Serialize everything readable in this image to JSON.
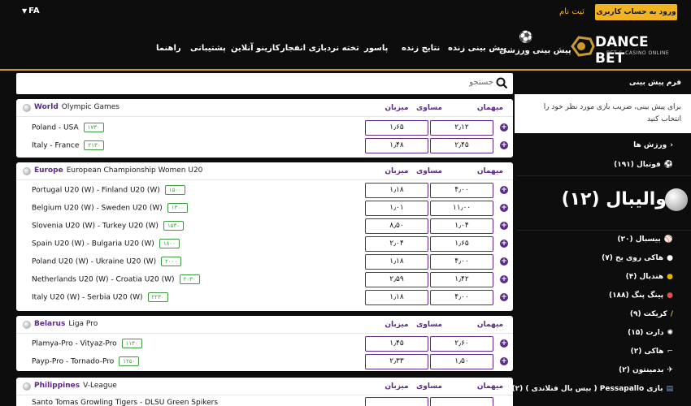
{
  "topbar": {
    "language": "FA",
    "login_label": "ورود به حساب کاربری",
    "register_label": "ثبت نام"
  },
  "header": {
    "logo_text": "DANCE BET",
    "logo_tagline": "BET & CASINO ONLINE",
    "sport_prediction_label": "پیش بینی ورزشی",
    "nav": [
      "پیش بینی زنده",
      "نتایج زنده",
      "پاسور",
      "تخته نرد",
      "بازی انفجار",
      "کازینو آنلاین",
      "پشتیبانی",
      "راهنما"
    ]
  },
  "search": {
    "placeholder": "جستجو"
  },
  "columns": {
    "home": "میزبان",
    "draw": "مساوی",
    "away": "میهمان"
  },
  "leagues": [
    {
      "region": "World",
      "name": "Olympic Games",
      "matches": [
        {
          "teams": "Poland - USA",
          "more": "۱۷۳۰",
          "home": "۱٫۶۵",
          "draw": "",
          "away": "۲٫۱۲"
        },
        {
          "teams": "Italy - France",
          "more": "۲۱۳۰",
          "home": "۱٫۴۸",
          "draw": "",
          "away": "۲٫۴۵"
        }
      ]
    },
    {
      "region": "Europe",
      "name": "European Championship Women U20",
      "matches": [
        {
          "teams": "Portugal U20 (W) - Finland U20 (W)",
          "more": "۱۵۰۰",
          "home": "۱٫۱۸",
          "draw": "",
          "away": "۴٫۰۰"
        },
        {
          "teams": "Belgium U20 (W) - Sweden U20 (W)",
          "more": "۱۳۰۰",
          "home": "۱٫۰۱",
          "draw": "",
          "away": "۱۱٫۰۰"
        },
        {
          "teams": "Slovenia U20 (W) - Turkey U20 (W)",
          "more": "۱۵۳۰",
          "home": "۸٫۵۰",
          "draw": "",
          "away": "۱٫۰۴"
        },
        {
          "teams": "Spain U20 (W) - Bulgaria U20 (W)",
          "more": "۱۸۰۰",
          "home": "۲٫۰۴",
          "draw": "",
          "away": "۱٫۶۵"
        },
        {
          "teams": "Poland U20 (W) - Ukraine U20 (W)",
          "more": "۲۰۰۰",
          "home": "۱٫۱۸",
          "draw": "",
          "away": "۴٫۰۰"
        },
        {
          "teams": "Netherlands U20 (W) - Croatia U20 (W)",
          "more": "۲۰۳۰",
          "home": "۲٫۵۹",
          "draw": "",
          "away": "۱٫۴۲"
        },
        {
          "teams": "Italy U20 (W) - Serbia U20 (W)",
          "more": "۲۲۳۰",
          "home": "۱٫۱۸",
          "draw": "",
          "away": "۴٫۰۰"
        }
      ]
    },
    {
      "region": "Belarus",
      "name": "Liga Pro",
      "matches": [
        {
          "teams": "Plamya-Pro - Vityaz-Pro",
          "more": "۱۱۳۰",
          "home": "۱٫۴۵",
          "draw": "",
          "away": "۲٫۶۰"
        },
        {
          "teams": "Payp-Pro - Tornado-Pro",
          "more": "۱۲۵۰",
          "home": "۲٫۳۳",
          "draw": "",
          "away": "۱٫۵۰"
        }
      ]
    },
    {
      "region": "Philippines",
      "name": "V-League",
      "matches": [
        {
          "teams": "Santo Tomas Growling Tigers - DLSU Green Spikers",
          "more": "",
          "home": "",
          "draw": "",
          "away": ""
        }
      ]
    }
  ],
  "betslip": {
    "title": "فرم پیش بینی",
    "message": "برای پیش بینی، ضریب بازی مورد نظر خود را انتخاب کنید"
  },
  "sports": {
    "heading": "ورزش ها",
    "football": "فوتبال (۱۹۱)",
    "volleyball": "والیبال (۱۲)",
    "list": [
      {
        "label": "بیسبال (۲۰)",
        "icon": "baseball-icon"
      },
      {
        "label": "هاکی روی یخ (۷)",
        "icon": "ice-hockey-icon"
      },
      {
        "label": "هندبال (۴)",
        "icon": "handball-icon"
      },
      {
        "label": "پینگ پنگ (۱۸۸)",
        "icon": "ping-pong-icon"
      },
      {
        "label": "کریکت (۹)",
        "icon": "cricket-icon"
      },
      {
        "label": "دارت (۱۵)",
        "icon": "darts-icon"
      },
      {
        "label": "هاکی (۲)",
        "icon": "hockey-icon"
      },
      {
        "label": "بدمینتون (۲)",
        "icon": "badminton-icon"
      },
      {
        "label": "بازی Pessapallo ( بیس بال فنلاندی ) (۲)",
        "icon": "pessapallo-icon"
      }
    ]
  },
  "colors": {
    "accent": "#f2b321",
    "purple": "#5b2a86",
    "green": "#3f9b3f"
  }
}
